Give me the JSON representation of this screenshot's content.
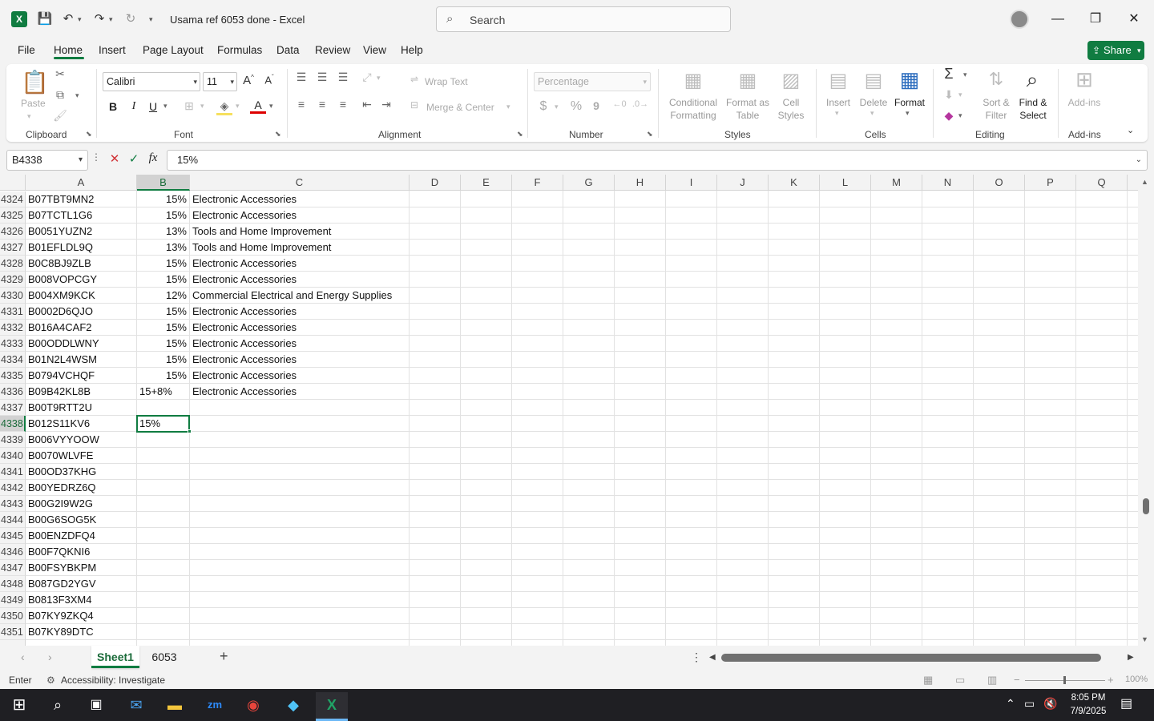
{
  "titlebar": {
    "doc_title": "Usama ref 6053 done  -  Excel",
    "search_placeholder": "Search",
    "window_buttons": [
      "minimize",
      "restore",
      "close"
    ]
  },
  "menu": {
    "items": [
      "File",
      "Home",
      "Insert",
      "Page Layout",
      "Formulas",
      "Data",
      "Review",
      "View",
      "Help"
    ],
    "active": "Home",
    "share_label": "Share"
  },
  "ribbon": {
    "clipboard": {
      "label": "Clipboard",
      "paste": "Paste"
    },
    "font": {
      "label": "Font",
      "family": "Calibri",
      "size": "11",
      "bold": "B",
      "italic": "I",
      "underline": "U"
    },
    "alignment": {
      "label": "Alignment",
      "wrap_text": "Wrap Text",
      "merge_center": "Merge & Center"
    },
    "number": {
      "label": "Number",
      "format": "Percentage",
      "currency": "$",
      "percent": "%",
      "comma": "9"
    },
    "styles": {
      "label": "Styles",
      "conditional": [
        "Conditional",
        "Formatting"
      ],
      "format_table": [
        "Format as",
        "Table"
      ],
      "cell_styles": [
        "Cell",
        "Styles"
      ]
    },
    "cells": {
      "label": "Cells",
      "insert": "Insert",
      "delete": "Delete",
      "format": "Format"
    },
    "editing": {
      "label": "Editing",
      "sort_filter": [
        "Sort &",
        "Filter"
      ],
      "find_select": [
        "Find &",
        "Select"
      ]
    },
    "addins": {
      "label": "Add-ins",
      "addins": "Add-ins"
    }
  },
  "formula_bar": {
    "name_box": "B4338",
    "formula": "15%"
  },
  "columns": [
    "A",
    "B",
    "C",
    "D",
    "E",
    "F",
    "G",
    "H",
    "I",
    "J",
    "K",
    "L",
    "M",
    "N",
    "O",
    "P",
    "Q"
  ],
  "selected_column": "B",
  "active_cell": "B4338",
  "rows": [
    {
      "num": "4324",
      "a": "B07TBT9MN2",
      "b": "15%",
      "c": "Electronic Accessories"
    },
    {
      "num": "4325",
      "a": "B07TCTL1G6",
      "b": "15%",
      "c": "Electronic Accessories"
    },
    {
      "num": "4326",
      "a": "B0051YUZN2",
      "b": "13%",
      "c": "Tools and Home Improvement"
    },
    {
      "num": "4327",
      "a": "B01EFLDL9Q",
      "b": "13%",
      "c": "Tools and Home Improvement"
    },
    {
      "num": "4328",
      "a": "B0C8BJ9ZLB",
      "b": "15%",
      "c": "Electronic Accessories"
    },
    {
      "num": "4329",
      "a": "B008VOPCGY",
      "b": "15%",
      "c": "Electronic Accessories"
    },
    {
      "num": "4330",
      "a": "B004XM9KCK",
      "b": "12%",
      "c": "Commercial Electrical and Energy Supplies"
    },
    {
      "num": "4331",
      "a": "B0002D6QJO",
      "b": "15%",
      "c": "Electronic Accessories"
    },
    {
      "num": "4332",
      "a": "B016A4CAF2",
      "b": "15%",
      "c": "Electronic Accessories"
    },
    {
      "num": "4333",
      "a": "B00ODDLWNY",
      "b": "15%",
      "c": "Electronic Accessories"
    },
    {
      "num": "4334",
      "a": "B01N2L4WSM",
      "b": "15%",
      "c": "Electronic Accessories"
    },
    {
      "num": "4335",
      "a": "B0794VCHQF",
      "b": "15%",
      "c": "Electronic Accessories"
    },
    {
      "num": "4336",
      "a": "B09B42KL8B",
      "b": "15+8%",
      "c": "Electronic Accessories"
    },
    {
      "num": "4337",
      "a": "B00T9RTT2U",
      "b": "",
      "c": ""
    },
    {
      "num": "4338",
      "a": "B012S11KV6",
      "b": "15%",
      "c": ""
    },
    {
      "num": "4339",
      "a": "B006VYYOOW",
      "b": "",
      "c": ""
    },
    {
      "num": "4340",
      "a": "B0070WLVFE",
      "b": "",
      "c": ""
    },
    {
      "num": "4341",
      "a": "B00OD37KHG",
      "b": "",
      "c": ""
    },
    {
      "num": "4342",
      "a": "B00YEDRZ6Q",
      "b": "",
      "c": ""
    },
    {
      "num": "4343",
      "a": "B00G2I9W2G",
      "b": "",
      "c": ""
    },
    {
      "num": "4344",
      "a": "B00G6SOG5K",
      "b": "",
      "c": ""
    },
    {
      "num": "4345",
      "a": "B00ENZDFQ4",
      "b": "",
      "c": ""
    },
    {
      "num": "4346",
      "a": "B00F7QKNI6",
      "b": "",
      "c": ""
    },
    {
      "num": "4347",
      "a": "B00FSYBKPM",
      "b": "",
      "c": ""
    },
    {
      "num": "4348",
      "a": "B087GD2YGV",
      "b": "",
      "c": ""
    },
    {
      "num": "4349",
      "a": "B0813F3XM4",
      "b": "",
      "c": ""
    },
    {
      "num": "4350",
      "a": "B07KY9ZKQ4",
      "b": "",
      "c": ""
    },
    {
      "num": "4351",
      "a": "B07KY89DTC",
      "b": "",
      "c": ""
    }
  ],
  "sheets": {
    "tabs": [
      "Sheet1",
      "6053"
    ],
    "active": "Sheet1"
  },
  "status": {
    "mode": "Enter",
    "accessibility": "Accessibility: Investigate",
    "zoom": "100%"
  },
  "taskbar": {
    "time": "8:05 PM",
    "date": "7/9/2025"
  },
  "colors": {
    "accent": "#107c41",
    "taskbar": "#1f1f23"
  }
}
